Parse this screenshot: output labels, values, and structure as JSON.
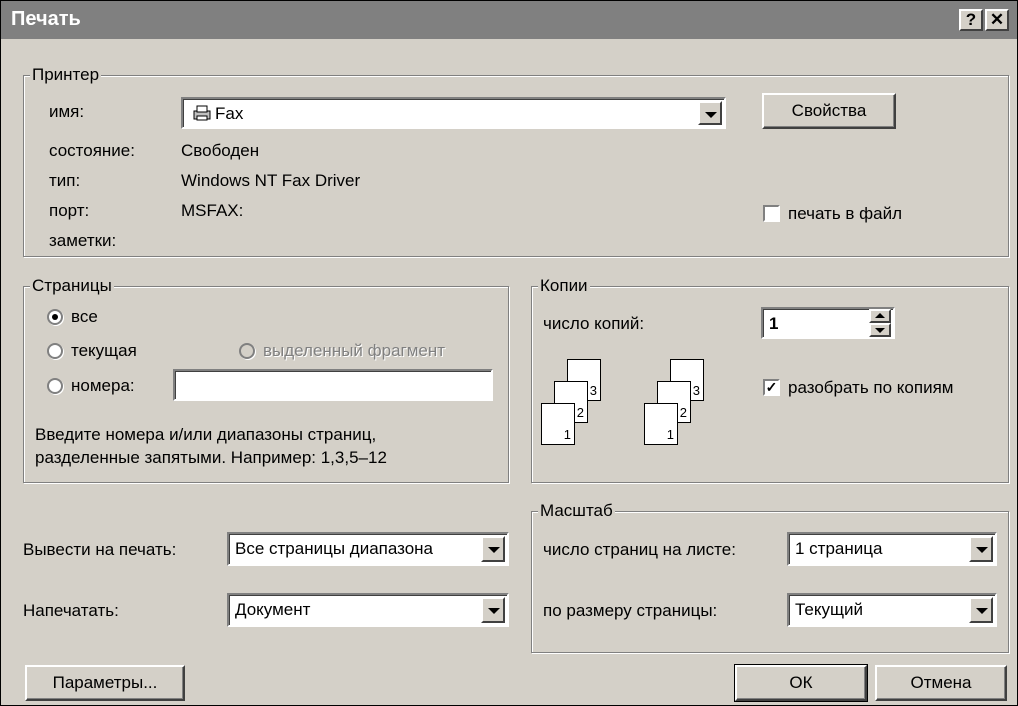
{
  "window": {
    "title": "Печать",
    "help_glyph": "?",
    "close_glyph": "✕"
  },
  "printer": {
    "group_label": "Принтер",
    "name_label": "имя:",
    "name_value": "Fax",
    "properties_button": "Свойства",
    "status_label": "состояние:",
    "status_value": "Свободен",
    "type_label": "тип:",
    "type_value": "Windows NT Fax Driver",
    "port_label": "порт:",
    "port_value": "MSFAX:",
    "notes_label": "заметки:",
    "print_to_file_label": "печать в файл",
    "print_to_file_checked": false
  },
  "pages": {
    "group_label": "Страницы",
    "all_label": "все",
    "current_label": "текущая",
    "selection_label": "выделенный фрагмент",
    "numbers_label": "номера:",
    "numbers_value": "",
    "selected": "all",
    "hint_line1": "Введите номера и/или диапазоны страниц,",
    "hint_line2": "разделенные запятыми. Например: 1,3,5–12"
  },
  "copies": {
    "group_label": "Копии",
    "count_label": "число копий:",
    "count_value": "1",
    "collate_label": "разобрать по копиям",
    "collate_checked": true,
    "collate_icon_pages": [
      "3",
      "2",
      "1"
    ]
  },
  "print_what": {
    "label": "Вывести на печать:",
    "value": "Все страницы диапазона"
  },
  "print": {
    "label": "Напечатать:",
    "value": "Документ"
  },
  "zoom": {
    "group_label": "Масштаб",
    "pages_per_sheet_label": "число страниц на листе:",
    "pages_per_sheet_value": "1 страница",
    "scale_to_paper_label": "по размеру страницы:",
    "scale_to_paper_value": "Текущий"
  },
  "buttons": {
    "options": "Параметры...",
    "ok": "ОК",
    "cancel": "Отмена"
  }
}
